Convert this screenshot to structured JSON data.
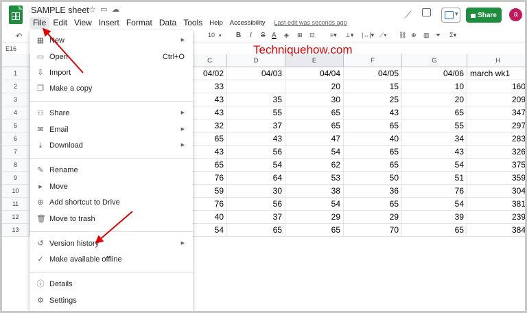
{
  "header": {
    "doc_title": "SAMPLE sheet",
    "menus": [
      "File",
      "Edit",
      "View",
      "Insert",
      "Format",
      "Data",
      "Tools"
    ],
    "menus_small": [
      "Help",
      "Accessibility"
    ],
    "last_edit": "Last edit was seconds ago",
    "share_label": "Share",
    "avatar_letter": "a"
  },
  "toolbar": {
    "font_size": "10",
    "bold": "B",
    "italic": "I",
    "strike": "S",
    "text_color": "A"
  },
  "namebox": "E16",
  "watermark": "Techniquehow.com",
  "grid": {
    "columns": [
      "C",
      "D",
      "E",
      "F",
      "G",
      "H"
    ],
    "rows": [
      "1",
      "2",
      "3",
      "4",
      "5",
      "6",
      "7",
      "8",
      "9",
      "10",
      "11",
      "12",
      "13"
    ],
    "header_row": [
      "04/02",
      "04/03",
      "04/04",
      "04/05",
      "04/06",
      "march wk1"
    ],
    "data": [
      [
        "33",
        "",
        "20",
        "15",
        "10",
        "160"
      ],
      [
        "43",
        "35",
        "30",
        "25",
        "20",
        "209"
      ],
      [
        "43",
        "55",
        "65",
        "43",
        "65",
        "347"
      ],
      [
        "32",
        "37",
        "65",
        "65",
        "55",
        "297"
      ],
      [
        "65",
        "43",
        "47",
        "40",
        "34",
        "283"
      ],
      [
        "43",
        "56",
        "54",
        "65",
        "43",
        "326"
      ],
      [
        "65",
        "54",
        "62",
        "65",
        "54",
        "375"
      ],
      [
        "76",
        "64",
        "53",
        "50",
        "51",
        "359"
      ],
      [
        "59",
        "30",
        "38",
        "36",
        "76",
        "304"
      ],
      [
        "76",
        "56",
        "54",
        "65",
        "54",
        "381"
      ],
      [
        "40",
        "37",
        "29",
        "29",
        "39",
        "239"
      ],
      [
        "54",
        "65",
        "65",
        "70",
        "65",
        "384"
      ]
    ]
  },
  "file_menu": {
    "items": [
      {
        "icon": "new-icon",
        "label": "New",
        "shortcut": "",
        "submenu": true
      },
      {
        "icon": "open-icon",
        "label": "Open",
        "shortcut": "Ctrl+O",
        "submenu": false
      },
      {
        "icon": "import-icon",
        "label": "Import",
        "shortcut": "",
        "submenu": false
      },
      {
        "icon": "copy-icon",
        "label": "Make a copy",
        "shortcut": "",
        "submenu": false
      },
      {
        "icon": "share-icon",
        "label": "Share",
        "shortcut": "",
        "submenu": true
      },
      {
        "icon": "email-icon",
        "label": "Email",
        "shortcut": "",
        "submenu": true
      },
      {
        "icon": "download-icon",
        "label": "Download",
        "shortcut": "",
        "submenu": true
      },
      {
        "icon": "rename-icon",
        "label": "Rename",
        "shortcut": "",
        "submenu": false
      },
      {
        "icon": "move-icon",
        "label": "Move",
        "shortcut": "",
        "submenu": false
      },
      {
        "icon": "add-shortcut-icon",
        "label": "Add shortcut to Drive",
        "shortcut": "",
        "submenu": false
      },
      {
        "icon": "trash-icon",
        "label": "Move to trash",
        "shortcut": "",
        "submenu": false
      },
      {
        "icon": "history-icon",
        "label": "Version history",
        "shortcut": "",
        "submenu": true
      },
      {
        "icon": "offline-icon",
        "label": "Make available offline",
        "shortcut": "",
        "submenu": false
      },
      {
        "icon": "info-icon",
        "label": "Details",
        "shortcut": "",
        "submenu": false
      },
      {
        "icon": "settings-icon",
        "label": "Settings",
        "shortcut": "",
        "submenu": false
      }
    ]
  },
  "colors": {
    "accent_green": "#1e8e3e",
    "annotation_red": "#e30000",
    "avatar": "#c2185b"
  }
}
